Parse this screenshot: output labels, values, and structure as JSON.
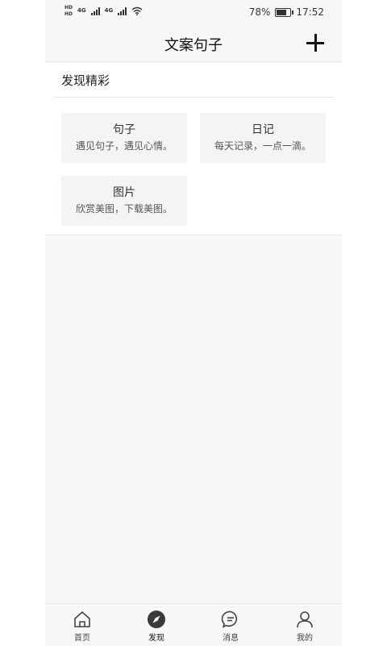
{
  "status_bar": {
    "hd1": "HD",
    "hd2": "HD",
    "net1": "4G",
    "net2": "4G",
    "battery_percent_text": "78%",
    "battery_level": 0.78,
    "time": "17:52"
  },
  "header": {
    "title": "文案句子"
  },
  "section": {
    "title": "发现精彩"
  },
  "cards": [
    {
      "title": "句子",
      "subtitle": "遇见句子，遇见心情。"
    },
    {
      "title": "日记",
      "subtitle": "每天记录，一点一滴。"
    },
    {
      "title": "图片",
      "subtitle": "欣赏美图，下载美图。"
    }
  ],
  "nav": {
    "items": [
      {
        "label": "首页",
        "icon": "home-icon"
      },
      {
        "label": "发现",
        "icon": "compass-icon"
      },
      {
        "label": "消息",
        "icon": "chat-icon"
      },
      {
        "label": "我的",
        "icon": "user-icon"
      }
    ],
    "active_index": 1
  },
  "colors": {
    "background": "#f6f7f8",
    "card": "#f3f4f5",
    "text": "#111111"
  }
}
